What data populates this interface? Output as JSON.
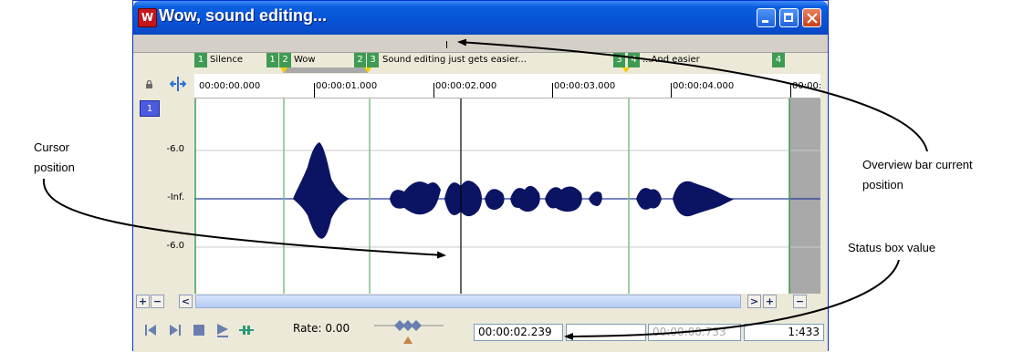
{
  "window": {
    "title": "Wow, sound editing..."
  },
  "markers": [
    {
      "num": "1",
      "label": "Silence"
    },
    {
      "num": "1",
      "label": ""
    },
    {
      "num": "2",
      "label": "Wow"
    },
    {
      "num": "2",
      "label": ""
    },
    {
      "num": "3",
      "label": "Sound editing just gets easier..."
    },
    {
      "num": "3",
      "label": ""
    },
    {
      "num": "4",
      "label": "...And easier"
    },
    {
      "num": "4",
      "label": ""
    }
  ],
  "ruler": {
    "labels": [
      "00:00:00.000",
      "00:00:01.000",
      "00:00:02.000",
      "00:00:03.000",
      "00:00:04.000",
      "00:00:0"
    ]
  },
  "channel": {
    "number": "1",
    "db_labels": [
      "-6.0",
      "-Inf.",
      "-6.0"
    ]
  },
  "scrollbar": {
    "zoom_in": "+",
    "zoom_out": "−",
    "left": "<",
    "right": ">"
  },
  "transport": {
    "rate_label": "Rate: 0.00",
    "cursor_position": "00:00:02.239",
    "selection_length": "00:00:00.733",
    "zoom_ratio": "1:433"
  },
  "annotations": {
    "cursor_position": [
      "Cursor",
      "position"
    ],
    "overview_bar": [
      "Overview bar current",
      "position"
    ],
    "status_box": [
      "Status box value"
    ]
  },
  "colors": {
    "waveform": "#0b1463",
    "marker": "#3f9b52",
    "titlebar": "#0853d6"
  }
}
